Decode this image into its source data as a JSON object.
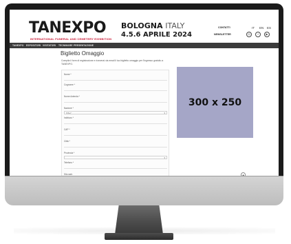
{
  "header": {
    "logo": "TANEXPO",
    "logo_sub": "INTERNATIONAL FUNERAL AND CEMETERY EXHIBITION",
    "city": "BOLOGNA",
    "country": "ITALY",
    "dates": "4.5.6 APRILE 2024",
    "contacts_label": "CONTATTI",
    "newsletter_label": "NEWSLETTER",
    "languages": [
      "IT",
      "EN",
      "ES"
    ],
    "social": [
      "instagram-icon",
      "facebook-icon",
      "youtube-icon"
    ]
  },
  "nav": {
    "items": [
      "TANEXPO",
      "ESPOSITORI",
      "VISITATORI",
      "TECNIMARE",
      "PRESENTAZIONE"
    ]
  },
  "main": {
    "title": "Biglietto Omaggio",
    "intro": "Compila il form di registrazione e riceverai via email il tuo biglietto omaggio per l'ingresso gratuito a TANEXPO.",
    "fields": [
      {
        "label": "Nome *",
        "type": "text"
      },
      {
        "label": "Cognome *",
        "type": "text"
      },
      {
        "label": "Nome Azienda *",
        "type": "text"
      },
      {
        "label": "Nazione *",
        "type": "select",
        "value": "ITALY"
      },
      {
        "label": "Indirizzo *",
        "type": "text"
      },
      {
        "label": "CAP *",
        "type": "text"
      },
      {
        "label": "Città *",
        "type": "text"
      },
      {
        "label": "Provincia *",
        "type": "select",
        "value": ""
      },
      {
        "label": "Telefono *",
        "type": "text"
      },
      {
        "label": "Sito web",
        "type": "text"
      }
    ]
  },
  "ad": {
    "label": "300 x 250",
    "bg_color": "#a5a6c7"
  }
}
